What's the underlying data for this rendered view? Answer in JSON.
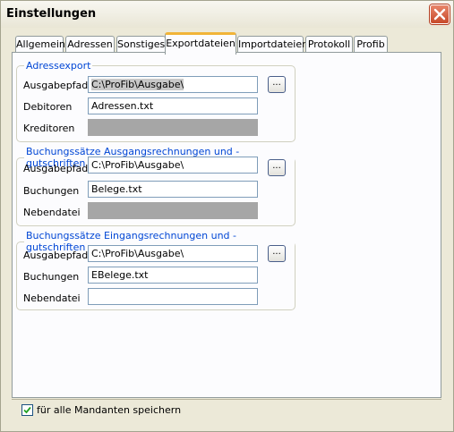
{
  "window": {
    "title": "Einstellungen"
  },
  "tabs": [
    {
      "label": "Allgemein"
    },
    {
      "label": "Adressen"
    },
    {
      "label": "Sonstiges"
    },
    {
      "label": "Exportdateien",
      "active": true
    },
    {
      "label": "Importdateien"
    },
    {
      "label": "Protokoll"
    },
    {
      "label": "Profib"
    }
  ],
  "groups": {
    "adressexport": {
      "legend": "Adressexport",
      "ausgabepfad_label": "Ausgabepfad",
      "ausgabepfad_value": "C:\\ProFib\\Ausgabe\\",
      "debitoren_label": "Debitoren",
      "debitoren_value": "Adressen.txt",
      "kreditoren_label": "Kreditoren",
      "kreditoren_value": ""
    },
    "ausgang": {
      "legend": "Buchungssätze Ausgangsrechnungen und -gutschriften",
      "ausgabepfad_label": "Ausgabepfad",
      "ausgabepfad_value": "C:\\ProFib\\Ausgabe\\",
      "buchungen_label": "Buchungen",
      "buchungen_value": "Belege.txt",
      "nebendatei_label": "Nebendatei",
      "nebendatei_value": ""
    },
    "eingang": {
      "legend": "Buchungssätze Eingangsrechnungen und -gutschriften",
      "ausgabepfad_label": "Ausgabepfad",
      "ausgabepfad_value": "C:\\ProFib\\Ausgabe\\",
      "buchungen_label": "Buchungen",
      "buchungen_value": "EBelege.txt",
      "nebendatei_label": "Nebendatei",
      "nebendatei_value": ""
    }
  },
  "browse_label": "...",
  "footer": {
    "checkbox_label": "für alle Mandanten speichern",
    "checked": true
  },
  "colors": {
    "accent_tab": "#f1b438",
    "legend": "#0046d5",
    "close_button": "#c74a2a"
  },
  "icons": [
    "close-icon",
    "check-icon"
  ]
}
